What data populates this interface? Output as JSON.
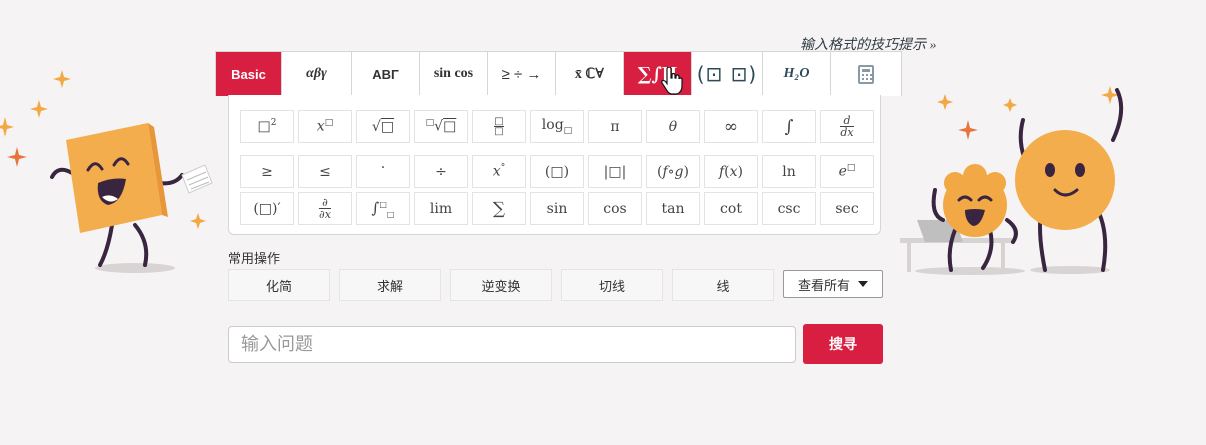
{
  "tips_link": "输入格式的技巧提示 »",
  "tabs": [
    {
      "label": "Basic",
      "name": "tab-basic",
      "active": false
    },
    {
      "label": "αβγ",
      "name": "tab-greek",
      "active": false
    },
    {
      "label": "ΑΒΓ",
      "name": "tab-greek-upper",
      "active": false
    },
    {
      "label": "sin cos",
      "name": "tab-trig",
      "active": false
    },
    {
      "label": "≥ ÷ →",
      "name": "tab-operators",
      "active": false
    },
    {
      "label": "x̄ ℂ∀",
      "name": "tab-sets",
      "active": false
    },
    {
      "label": "∑∫∏",
      "name": "tab-calculus",
      "active": true
    },
    {
      "label": "(⊡ ⊡)",
      "name": "tab-matrix",
      "active": false
    },
    {
      "label": "H₂O",
      "name": "tab-chemistry",
      "active": false
    },
    {
      "label": "",
      "name": "tab-calculator",
      "active": false
    }
  ],
  "keys": {
    "row1": [
      "□²",
      "x□",
      "√□",
      "□√□",
      "□/□",
      "log□",
      "π",
      "θ",
      "∞",
      "∫",
      "d/dx"
    ],
    "row2": [
      "≥",
      "≤",
      "·",
      "÷",
      "x°",
      "(□)",
      "|□|",
      "(f∘g)",
      "f(x)",
      "ln",
      "e□"
    ],
    "row3": [
      "(□)′",
      "∂/∂x",
      "∫□□",
      "lim",
      "∑",
      "sin",
      "cos",
      "tan",
      "cot",
      "csc",
      "sec"
    ]
  },
  "common_ops": {
    "label": "常用操作",
    "buttons": [
      "化简",
      "求解",
      "逆变换",
      "切线",
      "线"
    ],
    "view_all": "查看所有"
  },
  "search": {
    "placeholder": "输入问题",
    "button": "搜寻"
  },
  "colors": {
    "accent": "#d91f41",
    "character_orange": "#f2a844",
    "character_outline": "#3a2540"
  }
}
